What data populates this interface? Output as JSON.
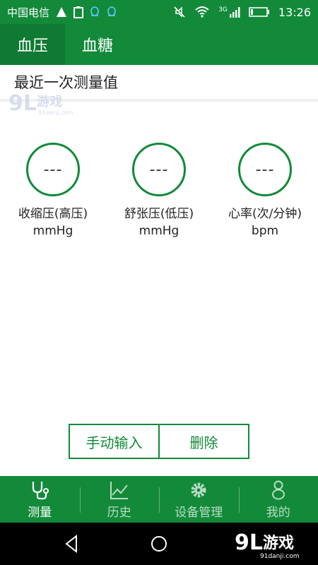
{
  "status_bar": {
    "carrier": "中国电信",
    "network": "3G",
    "time": "13:26"
  },
  "tabs": [
    {
      "label": "血压",
      "active": true
    },
    {
      "label": "血糖",
      "active": false
    }
  ],
  "section": {
    "title": "最近一次测量值"
  },
  "metrics": [
    {
      "value": "---",
      "label": "收缩压(高压)",
      "unit": "mmHg"
    },
    {
      "value": "---",
      "label": "舒张压(低压)",
      "unit": "mmHg"
    },
    {
      "value": "---",
      "label": "心率(次/分钟)",
      "unit": "bpm"
    }
  ],
  "actions": {
    "manual_input": "手动输入",
    "delete": "删除"
  },
  "bottom_nav": [
    {
      "label": "测量",
      "icon": "stethoscope-icon",
      "active": true
    },
    {
      "label": "历史",
      "icon": "chart-icon",
      "active": false
    },
    {
      "label": "设备管理",
      "icon": "gear-icon",
      "active": false
    },
    {
      "label": "我的",
      "icon": "person-icon",
      "active": false
    }
  ],
  "watermark": {
    "brand": "91游戏",
    "site": "91danji.com"
  },
  "colors": {
    "primary": "#128a3a",
    "primary_dark": "#0f7a32"
  }
}
